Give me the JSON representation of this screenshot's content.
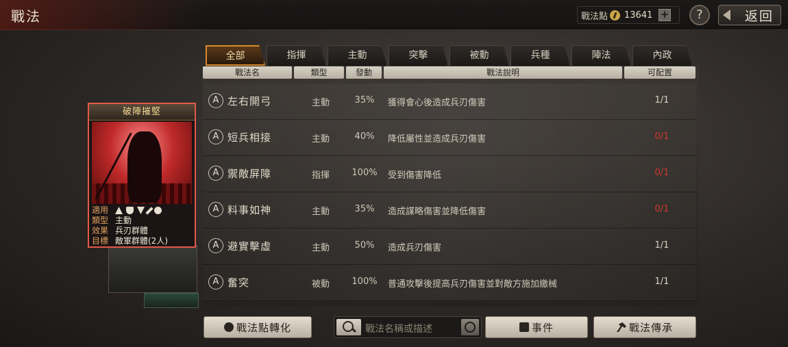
{
  "header": {
    "title": "戰法",
    "points_label": "戰法點",
    "points_value": "13641",
    "plus_label": "+",
    "help_label": "?",
    "back_label": "返回"
  },
  "tabs": [
    {
      "label": "全部",
      "active": true
    },
    {
      "label": "指揮",
      "active": false
    },
    {
      "label": "主動",
      "active": false
    },
    {
      "label": "突擊",
      "active": false
    },
    {
      "label": "被動",
      "active": false
    },
    {
      "label": "兵種",
      "active": false
    },
    {
      "label": "陣法",
      "active": false
    },
    {
      "label": "內政",
      "active": false
    }
  ],
  "columns": [
    "戰法名",
    "類型",
    "發動",
    "戰法說明",
    "可配置"
  ],
  "rows": [
    {
      "grade": "A",
      "name": "左右開弓",
      "type": "主動",
      "rate": "35%",
      "desc": "獲得會心後造成兵刃傷害",
      "config": "1/1",
      "config_red": false
    },
    {
      "grade": "A",
      "name": "短兵相接",
      "type": "主動",
      "rate": "40%",
      "desc": "降低屬性並造成兵刃傷害",
      "config": "0/1",
      "config_red": true
    },
    {
      "grade": "A",
      "name": "禦敵屏障",
      "type": "指揮",
      "rate": "100%",
      "desc": "受到傷害降低",
      "config": "0/1",
      "config_red": true
    },
    {
      "grade": "A",
      "name": "料事如神",
      "type": "主動",
      "rate": "35%",
      "desc": "造成謀略傷害並降低傷害",
      "config": "0/1",
      "config_red": true
    },
    {
      "grade": "A",
      "name": "避實擊虛",
      "type": "主動",
      "rate": "50%",
      "desc": "造成兵刃傷害",
      "config": "1/1",
      "config_red": false
    },
    {
      "grade": "A",
      "name": "奮突",
      "type": "被動",
      "rate": "100%",
      "desc": "普通攻擊後提高兵刃傷害並對敵方施加繳械",
      "config": "1/1",
      "config_red": false
    }
  ],
  "card": {
    "title": "破陣摧堅",
    "apply_label": "適用",
    "apply_icons": [
      "cavalry-icon",
      "shield-icon",
      "bow-icon",
      "spear-icon",
      "wheel-icon"
    ],
    "type_label": "類型",
    "type_value": "主動",
    "effect_label": "效果",
    "effect_value": "兵刃群體",
    "target_label": "目標",
    "target_value": "敵軍群體(2人)"
  },
  "bottom": {
    "convert_label": "戰法點轉化",
    "search_placeholder": "戰法名稱或描述",
    "event_label": "事件",
    "inherit_label": "戰法傳承"
  },
  "colors": {
    "accent_orange": "#d78a2a",
    "unavailable_red": "#d13a2a",
    "card_border": "#e45a4a"
  }
}
